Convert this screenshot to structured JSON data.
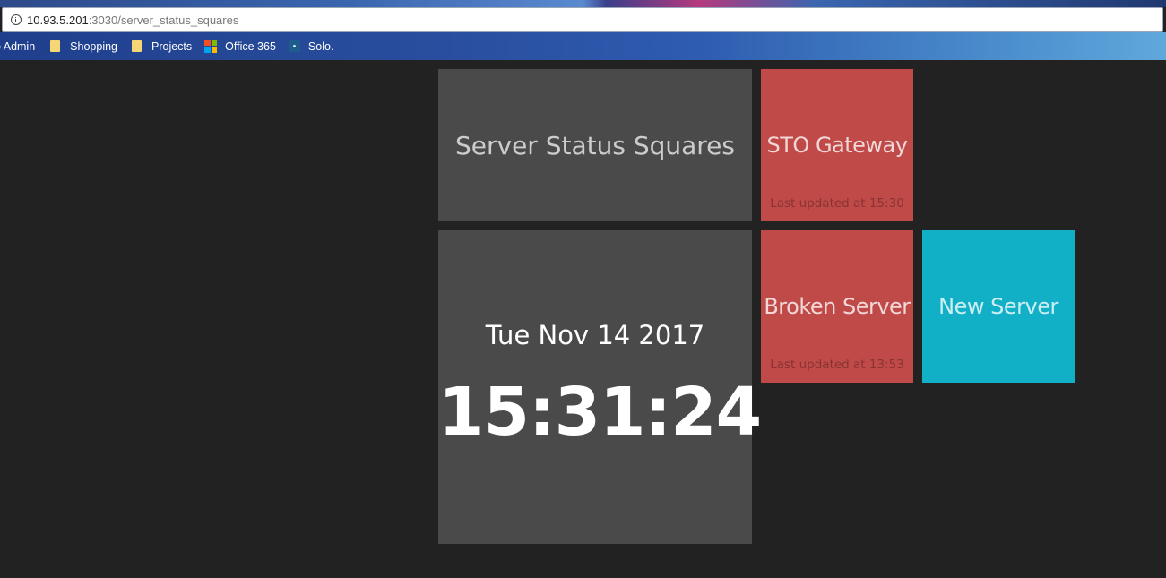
{
  "browser": {
    "url_host": "10.93.5.201",
    "url_rest": ":3030/server_status_squares",
    "bookmarks": [
      {
        "label": "o Admin",
        "icon": "none"
      },
      {
        "label": "Shopping",
        "icon": "folder-icon"
      },
      {
        "label": "Projects",
        "icon": "folder-icon"
      },
      {
        "label": "Office 365",
        "icon": "microsoft-icon"
      },
      {
        "label": "Solo.",
        "icon": "solo-icon"
      }
    ]
  },
  "dashboard": {
    "title": "Server Status Squares",
    "clock": {
      "date": "Tue Nov 14 2017",
      "time": "15:31:24"
    },
    "servers": [
      {
        "name": "STO Gateway",
        "updated": "Last updated at 15:30",
        "status_color": "#c04a48"
      },
      {
        "name": "Broken Server",
        "updated": "Last updated at 13:53",
        "status_color": "#c04a48"
      },
      {
        "name": "New Server",
        "updated": "",
        "status_color": "#12b0c6"
      }
    ]
  }
}
